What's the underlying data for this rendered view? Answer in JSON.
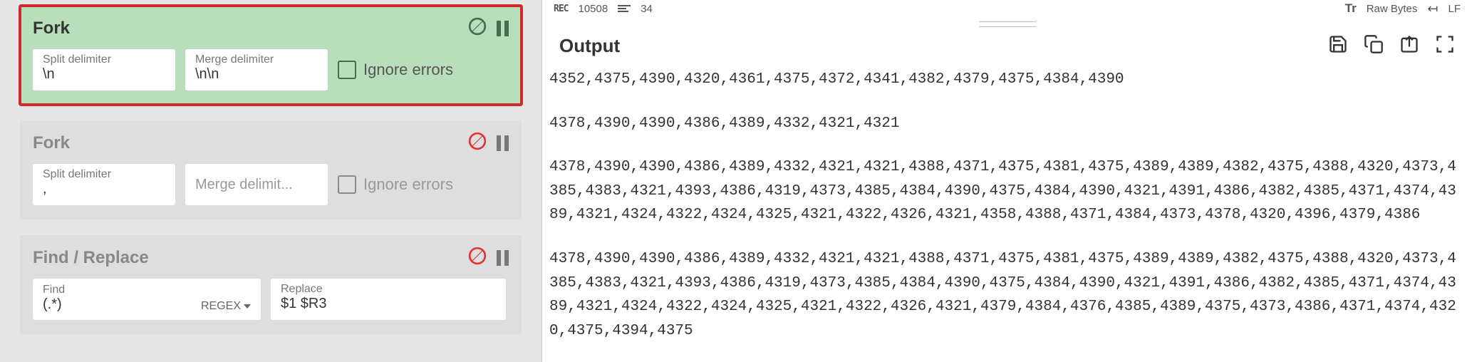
{
  "recipe": {
    "ops": [
      {
        "title": "Fork",
        "split_label": "Split delimiter",
        "split_value": "\\n",
        "merge_label": "Merge delimiter",
        "merge_value": "\\n\\n",
        "ignore_label": "Ignore errors"
      },
      {
        "title": "Fork",
        "split_label": "Split delimiter",
        "split_value": ",",
        "merge_label_placeholder": "Merge delimit...",
        "ignore_label": "Ignore errors"
      },
      {
        "title": "Find / Replace",
        "find_label": "Find",
        "find_value": "(.*)",
        "regex_label": "REGEX",
        "replace_label": "Replace",
        "replace_value": "$1 $R3"
      }
    ]
  },
  "status": {
    "rec_label": "REC",
    "rec_value": "10508",
    "lines_value": "34",
    "raw_label": "Raw Bytes",
    "eol_label": "LF"
  },
  "output": {
    "title": "Output",
    "blocks": [
      "4352,4375,4390,4320,4361,4375,4372,4341,4382,4379,4375,4384,4390",
      "4378,4390,4390,4386,4389,4332,4321,4321",
      "4378,4390,4390,4386,4389,4332,4321,4321,4388,4371,4375,4381,4375,4389,4389,4382,4375,4388,4320,4373,4385,4383,4321,4393,4386,4319,4373,4385,4384,4390,4375,4384,4390,4321,4391,4386,4382,4385,4371,4374,4389,4321,4324,4322,4324,4325,4321,4322,4326,4321,4358,4388,4371,4384,4373,4378,4320,4396,4379,4386",
      "4378,4390,4390,4386,4389,4332,4321,4321,4388,4371,4375,4381,4375,4389,4389,4382,4375,4388,4320,4373,4385,4383,4321,4393,4386,4319,4373,4385,4384,4390,4375,4384,4390,4321,4391,4386,4382,4385,4371,4374,4389,4321,4324,4322,4324,4325,4321,4322,4326,4321,4379,4384,4376,4385,4389,4375,4373,4386,4371,4374,4320,4375,4394,4375"
    ]
  }
}
